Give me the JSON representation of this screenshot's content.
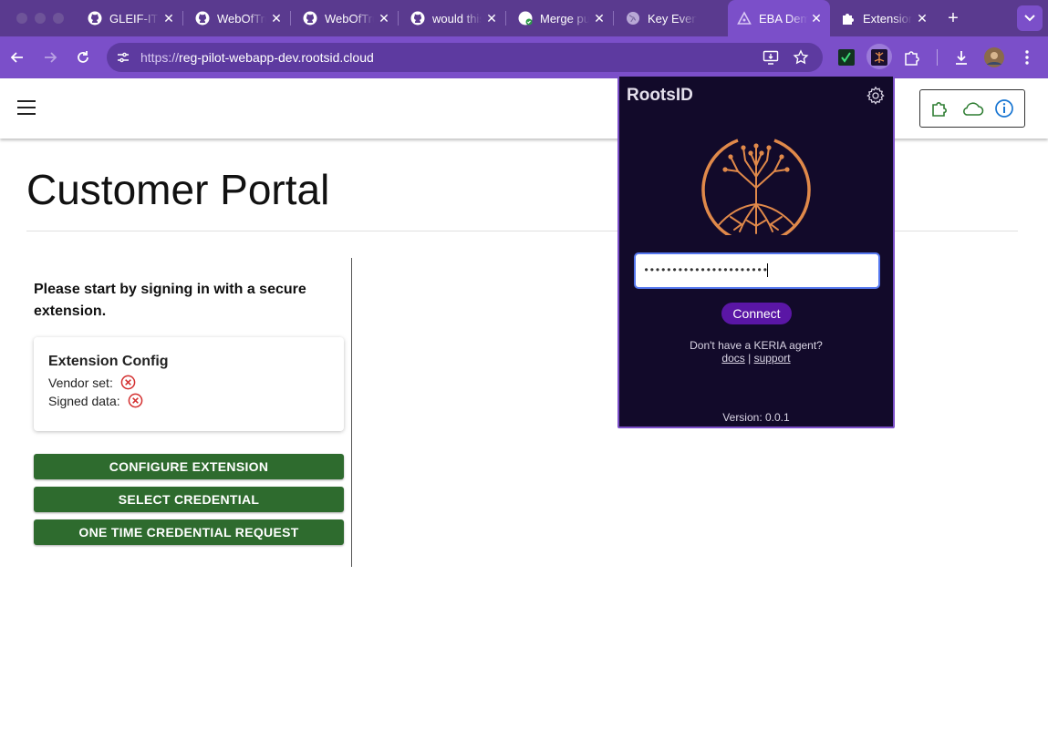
{
  "browser": {
    "tabs": [
      {
        "title": "GLEIF-IT",
        "icon": "github-icon"
      },
      {
        "title": "WebOfTrust",
        "icon": "github-icon"
      },
      {
        "title": "WebOfTrust",
        "icon": "github-icon"
      },
      {
        "title": "would this",
        "icon": "github-icon"
      },
      {
        "title": "Merge pull",
        "icon": "github-merge-icon"
      },
      {
        "title": "Key Event",
        "icon": "globe-icon"
      },
      {
        "title": "EBA Demo",
        "icon": "triangle-logo-icon",
        "active": true
      },
      {
        "title": "Extension",
        "icon": "puzzle-icon"
      }
    ],
    "new_tab_label": "+",
    "address": {
      "scheme": "https://",
      "host": "reg-pilot-webapp-dev.rootsid.cloud"
    },
    "colors": {
      "frame": "#5a3a8f",
      "toolbar": "#7b4fc9"
    }
  },
  "page": {
    "title": "Customer Portal",
    "intro": "Please start by signing in with a secure extension.",
    "config_card": {
      "title": "Extension Config",
      "vendor_label": "Vendor set:",
      "signed_label": "Signed data:",
      "vendor_status": "error-circle-icon",
      "signed_status": "error-circle-icon"
    },
    "buttons": {
      "configure": "CONFIGURE EXTENSION",
      "select": "SELECT CREDENTIAL",
      "one_time": "ONE TIME CREDENTIAL REQUEST"
    },
    "colors": {
      "button": "#2e6b2e",
      "error": "#d32f2f"
    }
  },
  "popup": {
    "title": "RootsID",
    "password_mask": "••••••••••••••••••••••",
    "connect_label": "Connect",
    "help_text": "Don't have a KERIA agent?",
    "docs_link": "docs",
    "separator": "|",
    "support_link": "support",
    "version": "Version: 0.0.1",
    "colors": {
      "background": "#120a2a",
      "accent": "#5a16a5",
      "logo": "#e0894a"
    }
  }
}
